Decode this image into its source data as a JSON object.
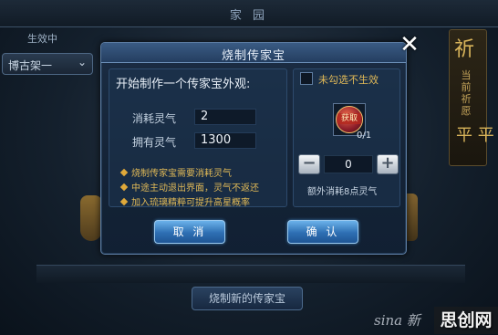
{
  "background": {
    "title": "家 园",
    "effective_label": "生效中",
    "select_value": "博古架一",
    "right_big_top": "祈",
    "right_small": "当前祈愿",
    "right_big_bottom": "平 平",
    "bottom_button": "烧制新的传家宝"
  },
  "dialog": {
    "title": "烧制传家宝",
    "prompt": "开始制作一个传家宝外观:",
    "cost_label": "消耗灵气",
    "cost_value": "2",
    "owned_label": "拥有灵气",
    "owned_value": "1300",
    "tips": [
      "烧制传家宝需要消耗灵气",
      "中途主动退出界面，灵气不返还",
      "加入琉璃精粹可提升高星概率"
    ],
    "checkbox_label": "未勾选不生效",
    "item_badge": "获取",
    "item_count": "0/1",
    "stepper_minus": "−",
    "stepper_value": "0",
    "stepper_plus": "+",
    "extra_cost": "额外消耗8点灵气",
    "cancel_label": "取 消",
    "confirm_label": "确 认"
  },
  "watermark": {
    "sina": "sina 新",
    "site": "思创网"
  },
  "colors": {
    "accent_gold": "#e0b957",
    "button_blue": "#2e6fb3",
    "panel_blue": "#1b2d44"
  },
  "icons": {
    "close": "close-icon",
    "chevron": "chevron-down-icon",
    "tip_bullet": "diamond-icon"
  }
}
